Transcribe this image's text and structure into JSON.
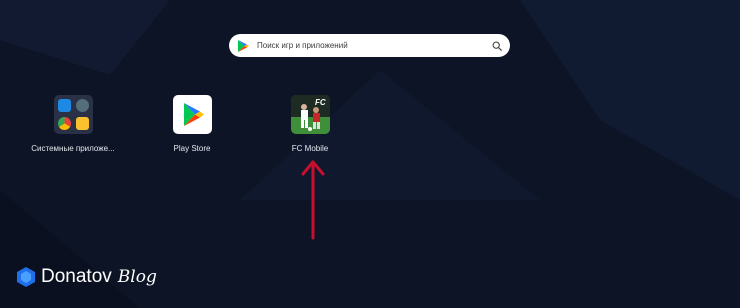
{
  "search": {
    "placeholder": "Поиск игр и приложений",
    "icon": "search-icon",
    "engine_icon": "play-store-icon"
  },
  "apps": [
    {
      "label": "Системные приложе...",
      "icon": "system-apps-folder-icon"
    },
    {
      "label": "Play Store",
      "icon": "play-store-icon"
    },
    {
      "label": "FC Mobile",
      "icon": "fc-mobile-icon"
    }
  ],
  "annotation": {
    "icon": "arrow-up-icon",
    "color": "#c8102e"
  },
  "watermark": {
    "brand": "Donatov",
    "sub": "Blog",
    "icon": "donatov-logo-icon"
  },
  "colors": {
    "background": "#0d1426",
    "accent_green": "#00c853",
    "accent_blue": "#2979ff"
  }
}
